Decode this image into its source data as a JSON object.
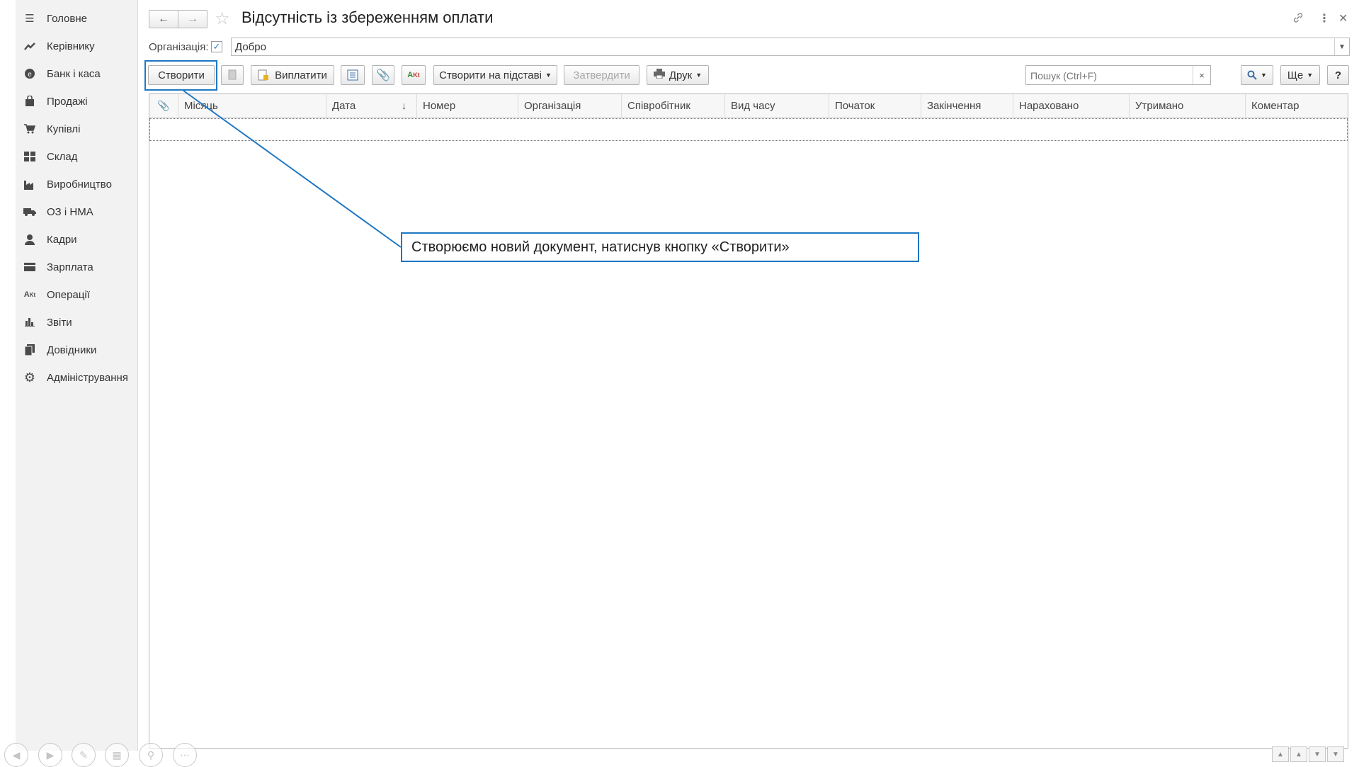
{
  "sidebar": {
    "items": [
      {
        "label": "Головне",
        "icon": "menu-icon"
      },
      {
        "label": "Керівнику",
        "icon": "trend-icon"
      },
      {
        "label": "Банк і каса",
        "icon": "bank-icon"
      },
      {
        "label": "Продажі",
        "icon": "bag-icon"
      },
      {
        "label": "Купівлі",
        "icon": "cart-icon"
      },
      {
        "label": "Склад",
        "icon": "warehouse-icon"
      },
      {
        "label": "Виробництво",
        "icon": "factory-icon"
      },
      {
        "label": "ОЗ і НМА",
        "icon": "truck-icon"
      },
      {
        "label": "Кадри",
        "icon": "person-icon"
      },
      {
        "label": "Зарплата",
        "icon": "card-icon"
      },
      {
        "label": "Операції",
        "icon": "operations-icon"
      },
      {
        "label": "Звіти",
        "icon": "bar-chart-icon"
      },
      {
        "label": "Довідники",
        "icon": "books-icon"
      },
      {
        "label": "Адміністрування",
        "icon": "gear-icon"
      }
    ]
  },
  "header": {
    "title": "Відсутність із збереженням оплати"
  },
  "filter": {
    "org_label": "Організація:",
    "org_checked": true,
    "org_value": "Добро"
  },
  "toolbar": {
    "create": "Створити",
    "pay": "Виплатити",
    "create_based": "Створити на підставі",
    "approve": "Затвердити",
    "print": "Друк",
    "search_placeholder": "Пошук (Ctrl+F)",
    "more": "Ще",
    "help": "?"
  },
  "table": {
    "columns": [
      "Місяць",
      "Дата",
      "Номер",
      "Організація",
      "Співробітник",
      "Вид часу",
      "Початок",
      "Закінчення",
      "Нараховано",
      "Утримано",
      "Коментар"
    ],
    "rows": []
  },
  "callout": {
    "text": "Створюємо новий документ, натиснув кнопку «Створити»"
  },
  "colors": {
    "accent": "#1f77c4",
    "sidebar_bg": "#f2f2f2"
  }
}
